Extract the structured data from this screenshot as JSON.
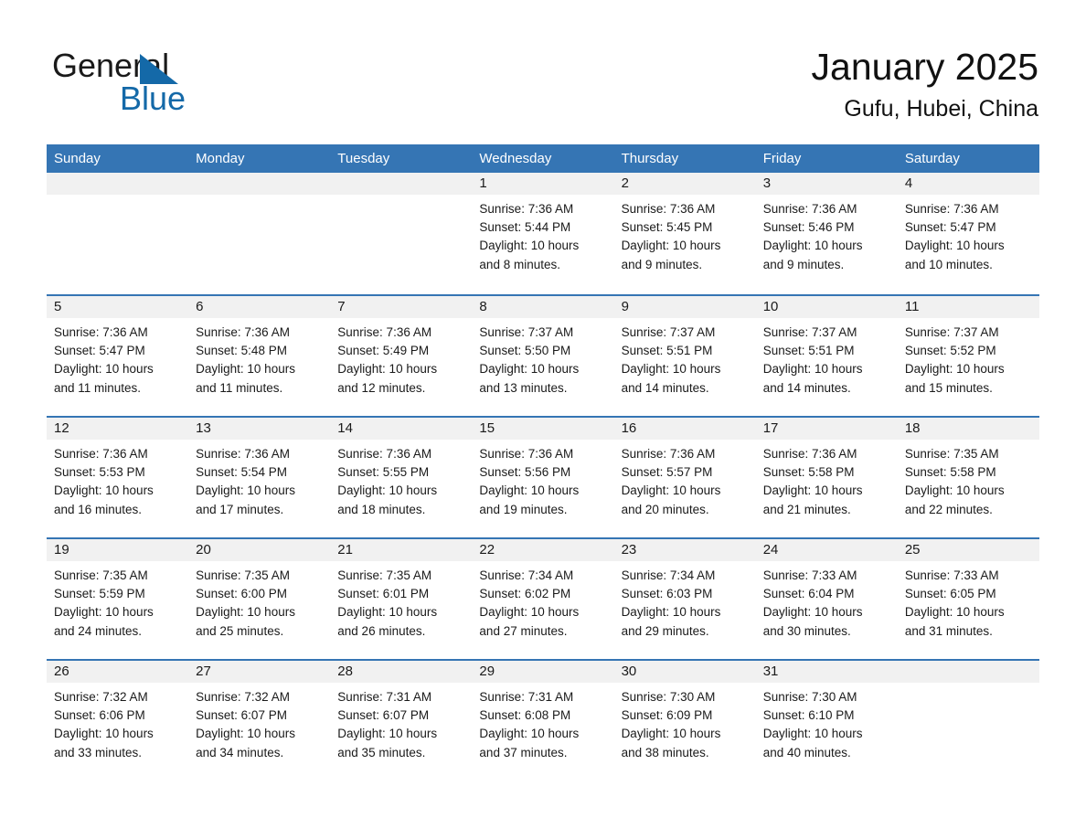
{
  "brand": {
    "word_one": "General",
    "word_two": "Blue",
    "triangle_color": "#1469a8",
    "blue_color": "#1469a8"
  },
  "header": {
    "title": "January 2025",
    "subtitle": "Gufu, Hubei, China"
  },
  "theme": {
    "header_blue": "#3575b4",
    "row_divider_blue": "#3575b4",
    "daynum_band": "#f1f1f1",
    "text": "#1a1a1a",
    "page_background": "#ffffff"
  },
  "weekdays": [
    "Sunday",
    "Monday",
    "Tuesday",
    "Wednesday",
    "Thursday",
    "Friday",
    "Saturday"
  ],
  "weeks": [
    [
      {
        "day": "",
        "sunrise": "",
        "sunset": "",
        "daylight_line1": "",
        "daylight_line2": ""
      },
      {
        "day": "",
        "sunrise": "",
        "sunset": "",
        "daylight_line1": "",
        "daylight_line2": ""
      },
      {
        "day": "",
        "sunrise": "",
        "sunset": "",
        "daylight_line1": "",
        "daylight_line2": ""
      },
      {
        "day": "1",
        "sunrise": "Sunrise: 7:36 AM",
        "sunset": "Sunset: 5:44 PM",
        "daylight_line1": "Daylight: 10 hours",
        "daylight_line2": "and 8 minutes."
      },
      {
        "day": "2",
        "sunrise": "Sunrise: 7:36 AM",
        "sunset": "Sunset: 5:45 PM",
        "daylight_line1": "Daylight: 10 hours",
        "daylight_line2": "and 9 minutes."
      },
      {
        "day": "3",
        "sunrise": "Sunrise: 7:36 AM",
        "sunset": "Sunset: 5:46 PM",
        "daylight_line1": "Daylight: 10 hours",
        "daylight_line2": "and 9 minutes."
      },
      {
        "day": "4",
        "sunrise": "Sunrise: 7:36 AM",
        "sunset": "Sunset: 5:47 PM",
        "daylight_line1": "Daylight: 10 hours",
        "daylight_line2": "and 10 minutes."
      }
    ],
    [
      {
        "day": "5",
        "sunrise": "Sunrise: 7:36 AM",
        "sunset": "Sunset: 5:47 PM",
        "daylight_line1": "Daylight: 10 hours",
        "daylight_line2": "and 11 minutes."
      },
      {
        "day": "6",
        "sunrise": "Sunrise: 7:36 AM",
        "sunset": "Sunset: 5:48 PM",
        "daylight_line1": "Daylight: 10 hours",
        "daylight_line2": "and 11 minutes."
      },
      {
        "day": "7",
        "sunrise": "Sunrise: 7:36 AM",
        "sunset": "Sunset: 5:49 PM",
        "daylight_line1": "Daylight: 10 hours",
        "daylight_line2": "and 12 minutes."
      },
      {
        "day": "8",
        "sunrise": "Sunrise: 7:37 AM",
        "sunset": "Sunset: 5:50 PM",
        "daylight_line1": "Daylight: 10 hours",
        "daylight_line2": "and 13 minutes."
      },
      {
        "day": "9",
        "sunrise": "Sunrise: 7:37 AM",
        "sunset": "Sunset: 5:51 PM",
        "daylight_line1": "Daylight: 10 hours",
        "daylight_line2": "and 14 minutes."
      },
      {
        "day": "10",
        "sunrise": "Sunrise: 7:37 AM",
        "sunset": "Sunset: 5:51 PM",
        "daylight_line1": "Daylight: 10 hours",
        "daylight_line2": "and 14 minutes."
      },
      {
        "day": "11",
        "sunrise": "Sunrise: 7:37 AM",
        "sunset": "Sunset: 5:52 PM",
        "daylight_line1": "Daylight: 10 hours",
        "daylight_line2": "and 15 minutes."
      }
    ],
    [
      {
        "day": "12",
        "sunrise": "Sunrise: 7:36 AM",
        "sunset": "Sunset: 5:53 PM",
        "daylight_line1": "Daylight: 10 hours",
        "daylight_line2": "and 16 minutes."
      },
      {
        "day": "13",
        "sunrise": "Sunrise: 7:36 AM",
        "sunset": "Sunset: 5:54 PM",
        "daylight_line1": "Daylight: 10 hours",
        "daylight_line2": "and 17 minutes."
      },
      {
        "day": "14",
        "sunrise": "Sunrise: 7:36 AM",
        "sunset": "Sunset: 5:55 PM",
        "daylight_line1": "Daylight: 10 hours",
        "daylight_line2": "and 18 minutes."
      },
      {
        "day": "15",
        "sunrise": "Sunrise: 7:36 AM",
        "sunset": "Sunset: 5:56 PM",
        "daylight_line1": "Daylight: 10 hours",
        "daylight_line2": "and 19 minutes."
      },
      {
        "day": "16",
        "sunrise": "Sunrise: 7:36 AM",
        "sunset": "Sunset: 5:57 PM",
        "daylight_line1": "Daylight: 10 hours",
        "daylight_line2": "and 20 minutes."
      },
      {
        "day": "17",
        "sunrise": "Sunrise: 7:36 AM",
        "sunset": "Sunset: 5:58 PM",
        "daylight_line1": "Daylight: 10 hours",
        "daylight_line2": "and 21 minutes."
      },
      {
        "day": "18",
        "sunrise": "Sunrise: 7:35 AM",
        "sunset": "Sunset: 5:58 PM",
        "daylight_line1": "Daylight: 10 hours",
        "daylight_line2": "and 22 minutes."
      }
    ],
    [
      {
        "day": "19",
        "sunrise": "Sunrise: 7:35 AM",
        "sunset": "Sunset: 5:59 PM",
        "daylight_line1": "Daylight: 10 hours",
        "daylight_line2": "and 24 minutes."
      },
      {
        "day": "20",
        "sunrise": "Sunrise: 7:35 AM",
        "sunset": "Sunset: 6:00 PM",
        "daylight_line1": "Daylight: 10 hours",
        "daylight_line2": "and 25 minutes."
      },
      {
        "day": "21",
        "sunrise": "Sunrise: 7:35 AM",
        "sunset": "Sunset: 6:01 PM",
        "daylight_line1": "Daylight: 10 hours",
        "daylight_line2": "and 26 minutes."
      },
      {
        "day": "22",
        "sunrise": "Sunrise: 7:34 AM",
        "sunset": "Sunset: 6:02 PM",
        "daylight_line1": "Daylight: 10 hours",
        "daylight_line2": "and 27 minutes."
      },
      {
        "day": "23",
        "sunrise": "Sunrise: 7:34 AM",
        "sunset": "Sunset: 6:03 PM",
        "daylight_line1": "Daylight: 10 hours",
        "daylight_line2": "and 29 minutes."
      },
      {
        "day": "24",
        "sunrise": "Sunrise: 7:33 AM",
        "sunset": "Sunset: 6:04 PM",
        "daylight_line1": "Daylight: 10 hours",
        "daylight_line2": "and 30 minutes."
      },
      {
        "day": "25",
        "sunrise": "Sunrise: 7:33 AM",
        "sunset": "Sunset: 6:05 PM",
        "daylight_line1": "Daylight: 10 hours",
        "daylight_line2": "and 31 minutes."
      }
    ],
    [
      {
        "day": "26",
        "sunrise": "Sunrise: 7:32 AM",
        "sunset": "Sunset: 6:06 PM",
        "daylight_line1": "Daylight: 10 hours",
        "daylight_line2": "and 33 minutes."
      },
      {
        "day": "27",
        "sunrise": "Sunrise: 7:32 AM",
        "sunset": "Sunset: 6:07 PM",
        "daylight_line1": "Daylight: 10 hours",
        "daylight_line2": "and 34 minutes."
      },
      {
        "day": "28",
        "sunrise": "Sunrise: 7:31 AM",
        "sunset": "Sunset: 6:07 PM",
        "daylight_line1": "Daylight: 10 hours",
        "daylight_line2": "and 35 minutes."
      },
      {
        "day": "29",
        "sunrise": "Sunrise: 7:31 AM",
        "sunset": "Sunset: 6:08 PM",
        "daylight_line1": "Daylight: 10 hours",
        "daylight_line2": "and 37 minutes."
      },
      {
        "day": "30",
        "sunrise": "Sunrise: 7:30 AM",
        "sunset": "Sunset: 6:09 PM",
        "daylight_line1": "Daylight: 10 hours",
        "daylight_line2": "and 38 minutes."
      },
      {
        "day": "31",
        "sunrise": "Sunrise: 7:30 AM",
        "sunset": "Sunset: 6:10 PM",
        "daylight_line1": "Daylight: 10 hours",
        "daylight_line2": "and 40 minutes."
      },
      {
        "day": "",
        "sunrise": "",
        "sunset": "",
        "daylight_line1": "",
        "daylight_line2": ""
      }
    ]
  ]
}
